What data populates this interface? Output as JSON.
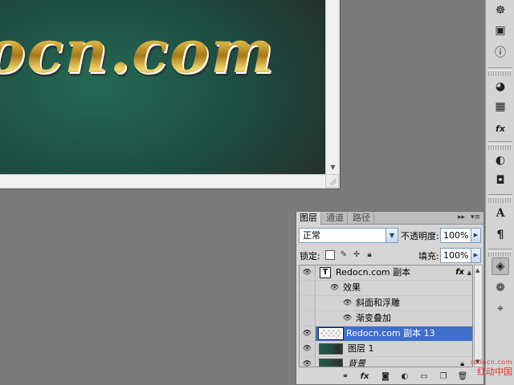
{
  "canvas": {
    "text": "ocn.com"
  },
  "dock": {
    "items": [
      {
        "name": "navigator-icon",
        "glyph": "☸"
      },
      {
        "name": "histogram-icon",
        "glyph": "▣"
      },
      {
        "name": "info-icon",
        "glyph": "ⓘ"
      },
      {
        "name": "color-icon",
        "glyph": "◕"
      },
      {
        "name": "swatches-icon",
        "glyph": "▦"
      },
      {
        "name": "styles-icon",
        "glyph": "fx"
      },
      {
        "name": "history-icon",
        "glyph": "◐"
      },
      {
        "name": "actions-icon",
        "glyph": "◘"
      },
      {
        "name": "character-icon",
        "glyph": "A"
      },
      {
        "name": "paragraph-icon",
        "glyph": "¶"
      },
      {
        "name": "layers-icon",
        "glyph": "◈"
      },
      {
        "name": "channels-icon",
        "glyph": "❁"
      },
      {
        "name": "paths-icon",
        "glyph": "⌖"
      }
    ]
  },
  "layers_panel": {
    "tabs": [
      "图层",
      "通道",
      "路径"
    ],
    "blend_mode": "正常",
    "opacity_label": "不透明度:",
    "opacity_value": "100%",
    "lock_label": "锁定:",
    "fill_label": "填充:",
    "fill_value": "100%",
    "rows": {
      "text_layer": {
        "name": "Redocn.com 副本",
        "thumb": "T",
        "fx": "fx"
      },
      "effects": "效果",
      "effect_1": "斜面和浮雕",
      "effect_2": "渐变叠加",
      "selected_layer": "Redocn.com 副本 13",
      "layer_1": "图层 1",
      "background": "背景"
    }
  },
  "watermark": {
    "url": "redocn.com",
    "text": "红动中国"
  }
}
